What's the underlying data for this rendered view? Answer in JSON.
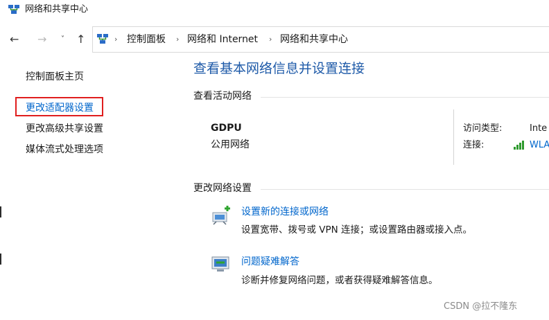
{
  "window": {
    "title": "网络和共享中心"
  },
  "navigation": {
    "back_icon": "←",
    "forward_icon": "→",
    "recent_icon": "˅",
    "up_icon": "↑",
    "breadcrumb": [
      "控制面板",
      "网络和 Internet",
      "网络和共享中心"
    ],
    "separator": "›"
  },
  "sidebar": {
    "items": [
      {
        "label": "控制面板主页"
      },
      {
        "label": "更改适配器设置",
        "highlighted": true
      },
      {
        "label": "更改高级共享设置"
      },
      {
        "label": "媒体流式处理选项"
      }
    ]
  },
  "main": {
    "title": "查看基本网络信息并设置连接",
    "active_section": "查看活动网络",
    "network": {
      "name": "GDPU",
      "type": "公用网络",
      "access_type_label": "访问类型:",
      "access_type_value": "Inte",
      "connection_label": "连接:",
      "connection_value": "WLA"
    },
    "change_section": "更改网络设置",
    "tasks": [
      {
        "icon": "network-setup-icon",
        "link": "设置新的连接或网络",
        "desc": "设置宽带、拨号或 VPN 连接；或设置路由器或接入点。"
      },
      {
        "icon": "troubleshoot-icon",
        "link": "问题疑难解答",
        "desc": "诊断并修复网络问题，或者获得疑难解答信息。"
      }
    ]
  },
  "watermark": "CSDN @拉不隆东",
  "colors": {
    "link": "#0066cc",
    "title": "#1e5aa8",
    "highlight_border": "#e01d1d"
  }
}
